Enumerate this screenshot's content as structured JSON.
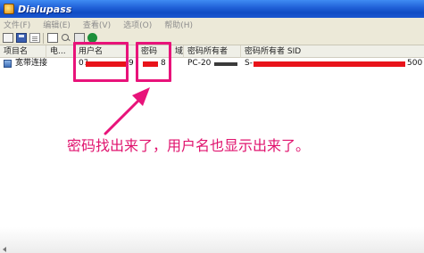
{
  "window": {
    "title": "Dialupass"
  },
  "menubar": {
    "items": [
      "文件(F)",
      "编辑(E)",
      "查看(V)",
      "选项(O)",
      "帮助(H)"
    ]
  },
  "toolbar": {
    "icons": [
      "view-icon",
      "save-icon",
      "document-icon",
      "copy-icon",
      "find-icon",
      "properties-icon",
      "help-icon"
    ]
  },
  "listview": {
    "columns": [
      "项目名",
      "电...",
      "用户名",
      "密码",
      "域",
      "密码所有者",
      "密码所有者 SID"
    ],
    "rows": [
      {
        "entry": "宽带连接",
        "phone": "",
        "username_start": "07",
        "username_end": "9",
        "password_end": "8",
        "domain": "",
        "owner": "PC-20",
        "owner_sid_start": "S-",
        "owner_sid_end": "500"
      }
    ]
  },
  "annotation": {
    "text": "密码找出来了，用户名也显示出来了。"
  },
  "colors": {
    "annotation": "#e0136e",
    "redaction": "#e8131a",
    "titlebar": "#1f5fd6"
  }
}
